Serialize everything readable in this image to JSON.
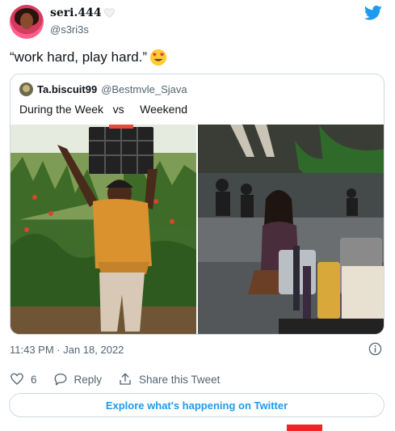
{
  "author": {
    "display_name": "seri.444",
    "handle": "@s3ri3s"
  },
  "tweet": {
    "text": "“work hard, play hard.”",
    "emoji": "heart-eyes-emoji"
  },
  "quoted_tweet": {
    "display_name": "Ta.biscuit99",
    "handle": "@Bestmvle_Sjava",
    "text": "During the Week   vs     Weekend",
    "images": [
      {
        "description_icon": "farm-photo"
      },
      {
        "description_icon": "lounge-photo"
      }
    ]
  },
  "meta": {
    "timestamp": "11:43 PM · Jan 18, 2022"
  },
  "actions": {
    "like_count": "6",
    "reply_label": "Reply",
    "share_label": "Share this Tweet"
  },
  "explore_label": "Explore what's happening on Twitter",
  "colors": {
    "twitter_blue": "#1d9bf0",
    "text_secondary": "#536471",
    "border": "#cfd9de"
  }
}
